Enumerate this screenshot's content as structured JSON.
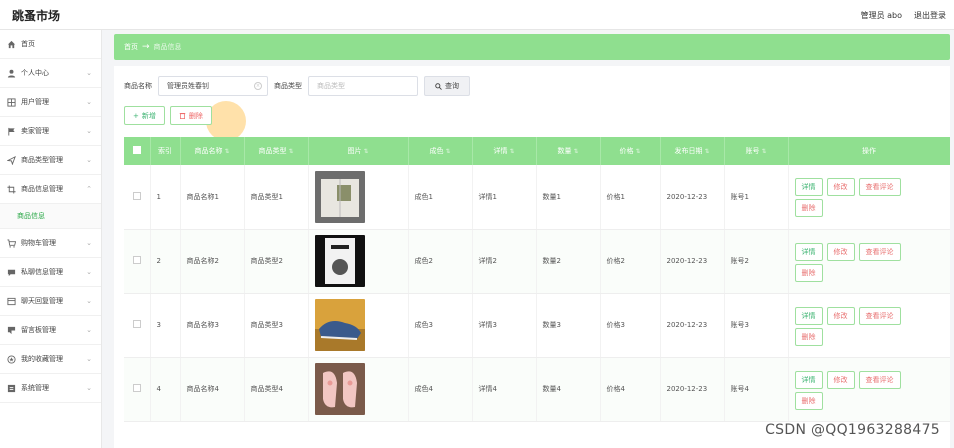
{
  "header": {
    "brand": "跳蚤市场",
    "admin": "管理员 abo",
    "logout": "退出登录"
  },
  "sidebar": {
    "items": [
      {
        "label": "首页",
        "icon": "home-icon",
        "chevron": false
      },
      {
        "label": "个人中心",
        "icon": "user-icon",
        "chevron": true
      },
      {
        "label": "用户管理",
        "icon": "grid-icon",
        "chevron": true
      },
      {
        "label": "卖家管理",
        "icon": "flag-icon",
        "chevron": true
      },
      {
        "label": "商品类型管理",
        "icon": "send-icon",
        "chevron": true
      },
      {
        "label": "商品信息管理",
        "icon": "crop-icon",
        "chevron": true,
        "expanded": true
      },
      {
        "label": "购物车管理",
        "icon": "cart-icon",
        "chevron": true
      },
      {
        "label": "私聊信息管理",
        "icon": "chat-icon",
        "chevron": true
      },
      {
        "label": "聊天回复管理",
        "icon": "reply-icon",
        "chevron": true
      },
      {
        "label": "留言板管理",
        "icon": "board-icon",
        "chevron": true
      },
      {
        "label": "我的收藏管理",
        "icon": "star-icon",
        "chevron": true
      },
      {
        "label": "系统管理",
        "icon": "system-icon",
        "chevron": true
      }
    ],
    "sub_item": "商品信息"
  },
  "breadcrumb": {
    "home": "首页",
    "current": "商品信息"
  },
  "search": {
    "name_label": "商品名称",
    "name_value": "管理员姓春钊",
    "type_label": "商品类型",
    "type_placeholder": "商品类型",
    "button": "查询"
  },
  "actions": {
    "add": "新增",
    "delete": "删除"
  },
  "table": {
    "columns": [
      "索引",
      "商品名称",
      "商品类型",
      "图片",
      "成色",
      "详情",
      "数量",
      "价格",
      "发布日期",
      "账号",
      "操作"
    ],
    "rows": [
      {
        "index": "1",
        "name": "商品名称1",
        "type": "商品类型1",
        "image": "book-cover-image",
        "condition": "成色1",
        "detail": "详情1",
        "quantity": "数量1",
        "price": "价格1",
        "date": "2020-12-23",
        "account": "账号1"
      },
      {
        "index": "2",
        "name": "商品名称2",
        "type": "商品类型2",
        "image": "box-image",
        "condition": "成色2",
        "detail": "详情2",
        "quantity": "数量2",
        "price": "价格2",
        "date": "2020-12-23",
        "account": "账号2"
      },
      {
        "index": "3",
        "name": "商品名称3",
        "type": "商品类型3",
        "image": "shoes-image",
        "condition": "成色3",
        "detail": "详情3",
        "quantity": "数量3",
        "price": "价格3",
        "date": "2020-12-23",
        "account": "账号3"
      },
      {
        "index": "4",
        "name": "商品名称4",
        "type": "商品类型4",
        "image": "pink-shoes-image",
        "condition": "成色4",
        "detail": "详情4",
        "quantity": "数量4",
        "price": "价格4",
        "date": "2020-12-23",
        "account": "账号4"
      }
    ],
    "ops": {
      "detail": "详情",
      "edit": "修改",
      "review": "查看评论",
      "delete": "删除"
    }
  },
  "colors": {
    "accent": "#8fdf8f",
    "accent_text": "#3cb371",
    "danger": "#e87070"
  },
  "watermark": "CSDN @QQ1963288475"
}
